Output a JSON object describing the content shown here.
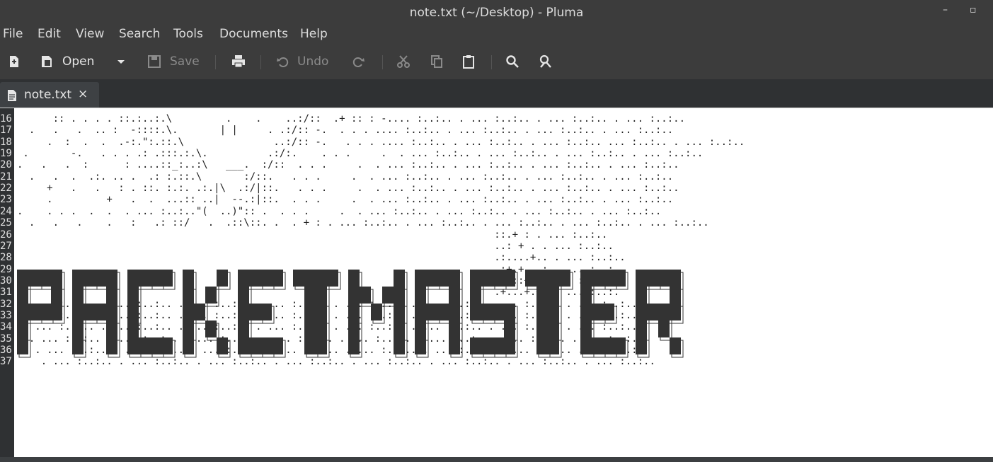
{
  "window": {
    "title": "note.txt (~/Desktop) - Pluma",
    "minimize": "–",
    "maximize": "▫"
  },
  "menu": [
    "File",
    "Edit",
    "View",
    "Search",
    "Tools",
    "Documents",
    "Help"
  ],
  "toolbar": {
    "open_label": "Open",
    "save_label": "Save",
    "undo_label": "Undo"
  },
  "tab": {
    "label": "note.txt",
    "close": "×"
  },
  "banner_text": "PACKETMASTER",
  "colors": {
    "chrome": "#3c3c3c",
    "gutter": "#2f3133",
    "editor_bg": "#ffffff",
    "banner": "#333333"
  },
  "lines": [
    {
      "num": "16",
      "text": "      :: . . . . ::.:..:.\\         .    .    ..:/::  .+ :: : -.... :..:.. . ... :..:.. . ... :..:.. . ... :..:.."
    },
    {
      "num": "17",
      "text": "  .   .   .  .. :  -::::.\\.       | |     . .:/:: -.  . . . .... :..:.. . ... :..:.. . ... :..:.. . ... :..:.."
    },
    {
      "num": "18",
      "text": "     .  :  .  .  .-:.\":.::.\\               ..:/:: -.   . . . .... :..:.. . ... :..:.. . ... :..:.. ... :..:.. . ... :..:.."
    },
    {
      "num": "19",
      "text": " .       -.   . . . .: .:::.:.\\.          .:/:.    . . .     .  . ... :..:.. . ... :..:.. . ... :..:.. . ... :..:.."
    },
    {
      "num": "20",
      "text": ".   .   .  :      : ....::_:..:\\   ___.  :/::  . . .     .  . ... :..:.. . ... :..:.. . ... :..:.. . ... :..:.."
    },
    {
      "num": "21",
      "text": "  .   .  .  .:. .. .  .: :.::.\\       :/::.   . . .     .  . ... :..:.. . ... :..:.. . ... :..:.. . ... :..:.."
    },
    {
      "num": "22",
      "text": "     +   .   .   : . ::. :.:. .:.|\\  .:/|::.   . . .     .  . ... :..:.. . ... :..:.. . ... :..:.. . ... :..:.."
    },
    {
      "num": "23",
      "text": "     .         +   .  .  ...:: ..|  --.:|::.  . . .     .  . ... :..:.. . ... :..:.. . ... :..:.. . ... :..:.."
    },
    {
      "num": "24",
      "text": ".    . . .  .  .  . ... :..:..\"(  ..)\":: .  . . .     .  . ... :..:.. . ... :..:.. . ... :..:.. . ... :..:.."
    },
    {
      "num": "25",
      "text": "  .   .   .    .   :   .: ::/   .  .::\\::. .  . + : . ... :..:.. . ... :..:.. . ... :..:.. . ... :..:.. . ... :..:.."
    },
    {
      "num": "26",
      "text": "                                                                                ::.+ : . ... :..:.."
    },
    {
      "num": "27",
      "text": "                                                                                ..: + . . ... :..:.."
    },
    {
      "num": "28",
      "text": "                                                                                .:....+.. . ... :..:.."
    },
    {
      "num": "29",
      "text": "                                                                                .:+.+...: . ... :..:.."
    },
    {
      "num": "30",
      "text": "                                                                                ...::+.+.. .. : .. :"
    },
    {
      "num": "31",
      "text": "                                                                                .+...+.+. . ... :..:."
    },
    {
      "num": "32",
      "text": " . ... :..:.. . ... :..:.. . ... :..:.. . ... :..:.. . ... :..:.. . ... :..:.. . ... :..:.. . ... :..:.."
    },
    {
      "num": "33",
      "text": " . ... :..:.. . ... :..:.. . ... :..:.. . ... :..:.. . ... :..:.. . ... :..:.. . ... :..:.. . ... :..:.."
    },
    {
      "num": "34",
      "text": " . ... :..:.. . ... :..:.. . ... :..:.. . ... :..:.. . ... :..:.. . ... :..:.. . ... :..:.. . ... :..:.."
    },
    {
      "num": "35",
      "text": "  . ... :..:.. . ... :..:.. . ... :..:.. . ... :..:.. . ... :..:.. . ... :..:.. . ... :..:.. . ... :..:.."
    },
    {
      "num": "36",
      "text": "   . ... :..:.. . ... :..:.. . ... :..:.. . ... :..:.. . ... :..:.. . ... :..:.. . ... :..:.. . ... :..:.."
    },
    {
      "num": "37",
      "text": "    . ... :..:.. . ... :..:.. . ... :..:.. . ... :..:.. . ... :..:.. . ... :..:.. . ... :..:.. . ... :..:.."
    }
  ]
}
